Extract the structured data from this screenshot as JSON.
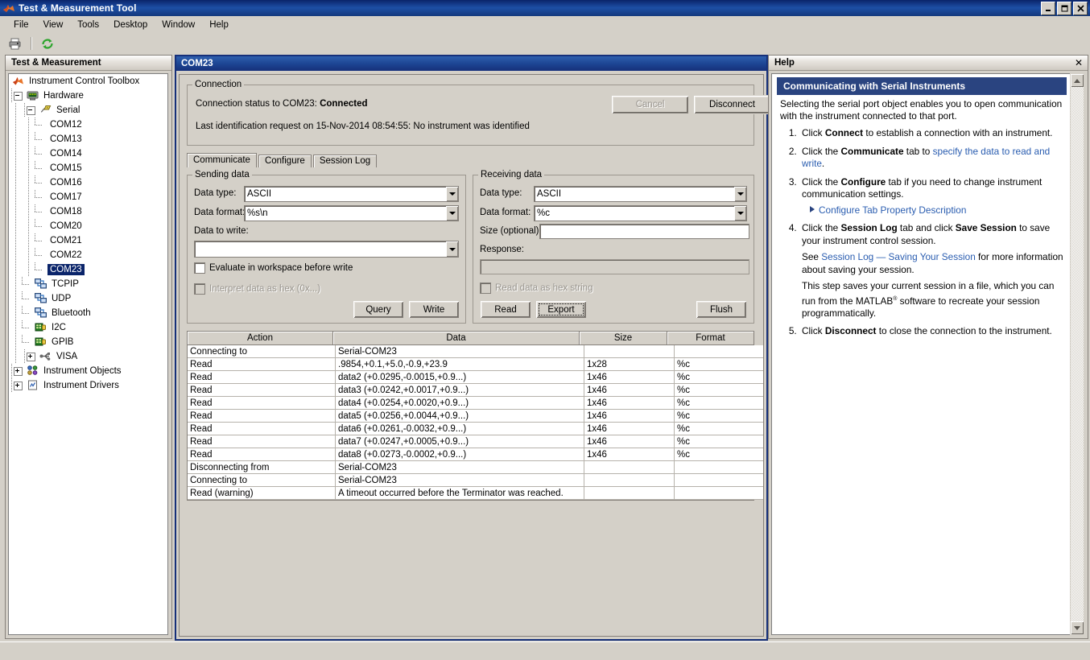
{
  "window": {
    "title": "Test & Measurement Tool",
    "icon": "matlab-icon",
    "buttons": {
      "minimize": "_",
      "maximize": "❑",
      "close": "✕"
    }
  },
  "menubar": {
    "items": [
      "File",
      "View",
      "Tools",
      "Desktop",
      "Window",
      "Help"
    ]
  },
  "toolbar": {
    "items": [
      {
        "name": "print-icon",
        "tip": "Print"
      },
      {
        "name": "refresh-icon",
        "tip": "Refresh"
      }
    ]
  },
  "sidebar": {
    "header": "Test & Measurement",
    "tree": [
      {
        "label": "Instrument Control Toolbox",
        "depth": 0,
        "icon": "matlab-icon",
        "expander": "none",
        "selected": false
      },
      {
        "label": "Hardware",
        "depth": 1,
        "icon": "hardware-icon",
        "expander": "minus",
        "selected": false
      },
      {
        "label": "Serial",
        "depth": 2,
        "icon": "serial-icon",
        "expander": "minus",
        "selected": false
      },
      {
        "label": "COM12",
        "depth": 3,
        "icon": "none",
        "expander": "none",
        "selected": false
      },
      {
        "label": "COM13",
        "depth": 3,
        "icon": "none",
        "expander": "none",
        "selected": false
      },
      {
        "label": "COM14",
        "depth": 3,
        "icon": "none",
        "expander": "none",
        "selected": false
      },
      {
        "label": "COM15",
        "depth": 3,
        "icon": "none",
        "expander": "none",
        "selected": false
      },
      {
        "label": "COM16",
        "depth": 3,
        "icon": "none",
        "expander": "none",
        "selected": false
      },
      {
        "label": "COM17",
        "depth": 3,
        "icon": "none",
        "expander": "none",
        "selected": false
      },
      {
        "label": "COM18",
        "depth": 3,
        "icon": "none",
        "expander": "none",
        "selected": false
      },
      {
        "label": "COM20",
        "depth": 3,
        "icon": "none",
        "expander": "none",
        "selected": false
      },
      {
        "label": "COM21",
        "depth": 3,
        "icon": "none",
        "expander": "none",
        "selected": false
      },
      {
        "label": "COM22",
        "depth": 3,
        "icon": "none",
        "expander": "none",
        "selected": false
      },
      {
        "label": "COM23",
        "depth": 3,
        "icon": "none",
        "expander": "none",
        "selected": true
      },
      {
        "label": "TCPIP",
        "depth": 2,
        "icon": "network-icon",
        "expander": "none",
        "selected": false
      },
      {
        "label": "UDP",
        "depth": 2,
        "icon": "network-icon",
        "expander": "none",
        "selected": false
      },
      {
        "label": "Bluetooth",
        "depth": 2,
        "icon": "network-icon",
        "expander": "none",
        "selected": false
      },
      {
        "label": "I2C",
        "depth": 2,
        "icon": "board-icon",
        "expander": "none",
        "selected": false
      },
      {
        "label": "GPIB",
        "depth": 2,
        "icon": "board-icon",
        "expander": "none",
        "selected": false
      },
      {
        "label": "VISA",
        "depth": 2,
        "icon": "usb-icon",
        "expander": "plus",
        "selected": false
      },
      {
        "label": "Instrument Objects",
        "depth": 1,
        "icon": "objects-icon",
        "expander": "plus",
        "selected": false
      },
      {
        "label": "Instrument Drivers",
        "depth": 1,
        "icon": "drivers-icon",
        "expander": "plus",
        "selected": false
      }
    ]
  },
  "document": {
    "title": "COM23",
    "connection": {
      "group_label": "Connection",
      "status_prefix": "Connection status to COM23: ",
      "status_value": "Connected",
      "last_id": "Last identification request on 15-Nov-2014 08:54:55: No instrument was identified",
      "cancel_label": "Cancel",
      "disconnect_label": "Disconnect"
    },
    "tabs": [
      {
        "label": "Communicate",
        "active": true
      },
      {
        "label": "Configure",
        "active": false
      },
      {
        "label": "Session Log",
        "active": false
      }
    ],
    "sending": {
      "group_label": "Sending data",
      "data_type_label": "Data type:",
      "data_type_value": "ASCII",
      "data_format_label": "Data format:",
      "data_format_value": "%s\\n",
      "data_to_write_label": "Data to write:",
      "data_to_write_value": "",
      "evaluate_label": "Evaluate in workspace before write",
      "evaluate_checked": false,
      "interpret_hex_label": "Interpret data as hex (0x...)",
      "interpret_hex_checked": false,
      "query_label": "Query",
      "write_label": "Write"
    },
    "receiving": {
      "group_label": "Receiving data",
      "data_type_label": "Data type:",
      "data_type_value": "ASCII",
      "data_format_label": "Data format:",
      "data_format_value": "%c",
      "size_label": "Size (optional):",
      "size_value": "",
      "response_label": "Response:",
      "response_value": "",
      "read_hex_label": "Read data as hex string",
      "read_hex_checked": false,
      "read_label": "Read",
      "export_label": "Export",
      "flush_label": "Flush"
    },
    "table": {
      "columns": [
        "Action",
        "Data",
        "Size",
        "Format"
      ],
      "rows": [
        [
          "Connecting to",
          "Serial-COM23",
          "",
          ""
        ],
        [
          "Read",
          ".9854,+0.1,+5.0,-0.9,+23.9",
          "1x28",
          "%c"
        ],
        [
          "Read",
          "data2 (+0.0295,-0.0015,+0.9...)",
          "1x46",
          "%c"
        ],
        [
          "Read",
          "data3 (+0.0242,+0.0017,+0.9...)",
          "1x46",
          "%c"
        ],
        [
          "Read",
          "data4 (+0.0254,+0.0020,+0.9...)",
          "1x46",
          "%c"
        ],
        [
          "Read",
          "data5 (+0.0256,+0.0044,+0.9...)",
          "1x46",
          "%c"
        ],
        [
          "Read",
          "data6 (+0.0261,-0.0032,+0.9...)",
          "1x46",
          "%c"
        ],
        [
          "Read",
          "data7 (+0.0247,+0.0005,+0.9...)",
          "1x46",
          "%c"
        ],
        [
          "Read",
          "data8 (+0.0273,-0.0002,+0.9...)",
          "1x46",
          "%c"
        ],
        [
          "Disconnecting from",
          "Serial-COM23",
          "",
          ""
        ],
        [
          "Connecting to",
          "Serial-COM23",
          "",
          ""
        ],
        [
          "Read (warning)",
          "A timeout occurred before the Terminator was reached.",
          "",
          ""
        ]
      ]
    }
  },
  "help": {
    "header": "Help",
    "close": "✕",
    "banner": "Communicating with Serial Instruments",
    "intro": "Selecting the serial port object enables you to open communication with the instrument connected to that port.",
    "steps": {
      "s1_a": "Click ",
      "s1_b": "Connect",
      "s1_c": " to establish a connection with an instrument.",
      "s2_a": "Click the ",
      "s2_b": "Communicate",
      "s2_c": " tab to ",
      "s2_link": "specify the data to read and write",
      "s2_d": ".",
      "s3_a": "Click the ",
      "s3_b": "Configure",
      "s3_c": " tab if you need to change instrument communication settings.",
      "s3_sublink": "Configure Tab Property Description",
      "s4_a": "Click the ",
      "s4_b": "Session Log",
      "s4_c": " tab and click ",
      "s4_d": "Save Session",
      "s4_e": " to save your instrument control session.",
      "s4_p2_a": "See ",
      "s4_p2_link": "Session Log — Saving Your Session",
      "s4_p2_b": " for more information about saving your session.",
      "s4_p3_a": "This step saves your current session in a file, which you can run from the MATLAB",
      "s4_p3_sup": "®",
      "s4_p3_b": " software to recreate your session programmatically.",
      "s5_a": "Click ",
      "s5_b": "Disconnect",
      "s5_c": " to close the connection to the instrument."
    }
  },
  "colors": {
    "window_face": "#d4d0c8",
    "titlebar": "#0a246a",
    "doc_title": "#16307a",
    "selection": "#0a246a",
    "help_banner": "#2a4480",
    "link": "#2a5db0"
  }
}
